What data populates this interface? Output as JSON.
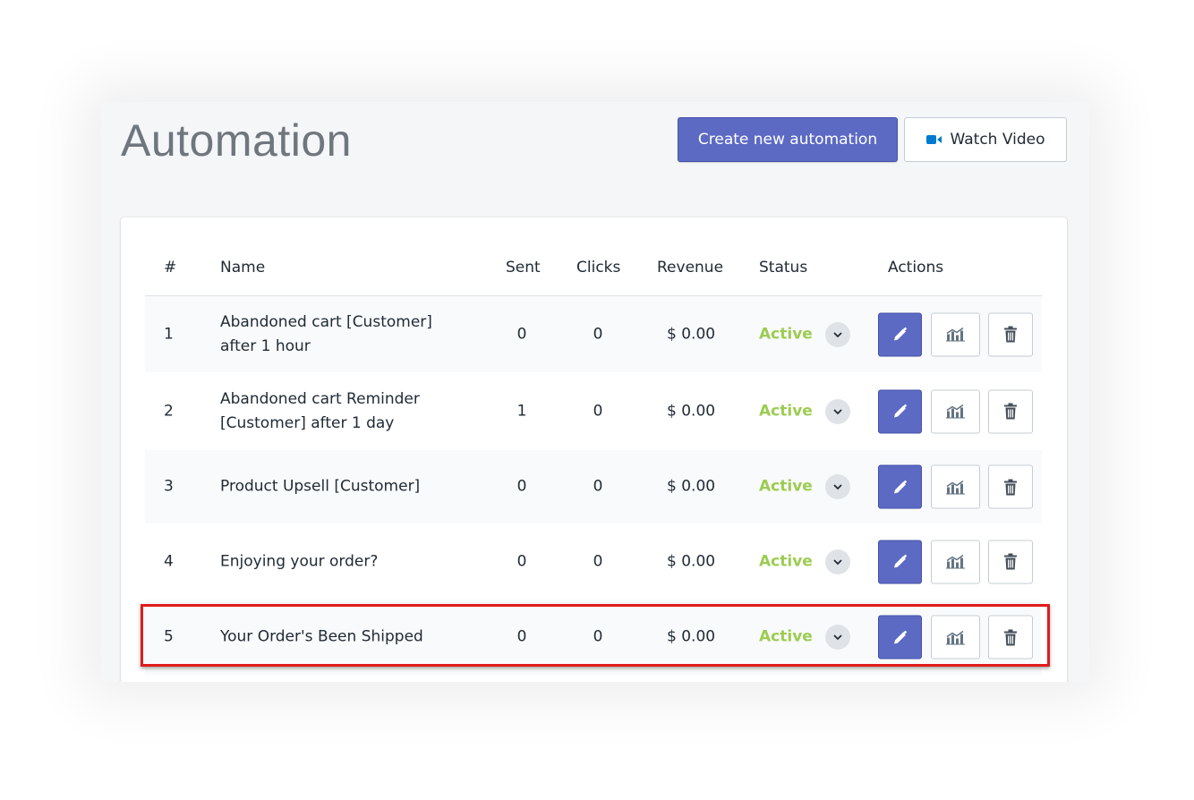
{
  "header": {
    "title": "Automation",
    "create_label": "Create new automation",
    "video_label": "Watch Video"
  },
  "table": {
    "columns": {
      "number": "#",
      "name": "Name",
      "sent": "Sent",
      "clicks": "Clicks",
      "revenue": "Revenue",
      "status": "Status",
      "actions": "Actions"
    },
    "rows": [
      {
        "number": "1",
        "name": "Abandoned cart [Customer] after 1 hour",
        "sent": "0",
        "clicks": "0",
        "revenue": "$ 0.00",
        "status": "Active"
      },
      {
        "number": "2",
        "name": "Abandoned cart Reminder [Customer] after 1 day",
        "sent": "1",
        "clicks": "0",
        "revenue": "$ 0.00",
        "status": "Active"
      },
      {
        "number": "3",
        "name": "Product Upsell [Customer]",
        "sent": "0",
        "clicks": "0",
        "revenue": "$ 0.00",
        "status": "Active"
      },
      {
        "number": "4",
        "name": "Enjoying your order?",
        "sent": "0",
        "clicks": "0",
        "revenue": "$ 0.00",
        "status": "Active"
      },
      {
        "number": "5",
        "name": "Your Order's Been Shipped",
        "sent": "0",
        "clicks": "0",
        "revenue": "$ 0.00",
        "status": "Active"
      }
    ]
  },
  "icons": {
    "video": "video-camera-icon",
    "chevron": "chevron-down-icon",
    "edit": "pencil-icon",
    "stats": "bar-chart-icon",
    "delete": "trash-icon"
  },
  "colors": {
    "primary": "#5c6ac4",
    "active_status": "#9ccc51",
    "video_icon": "#007ace",
    "highlight": "#e01b1b"
  }
}
